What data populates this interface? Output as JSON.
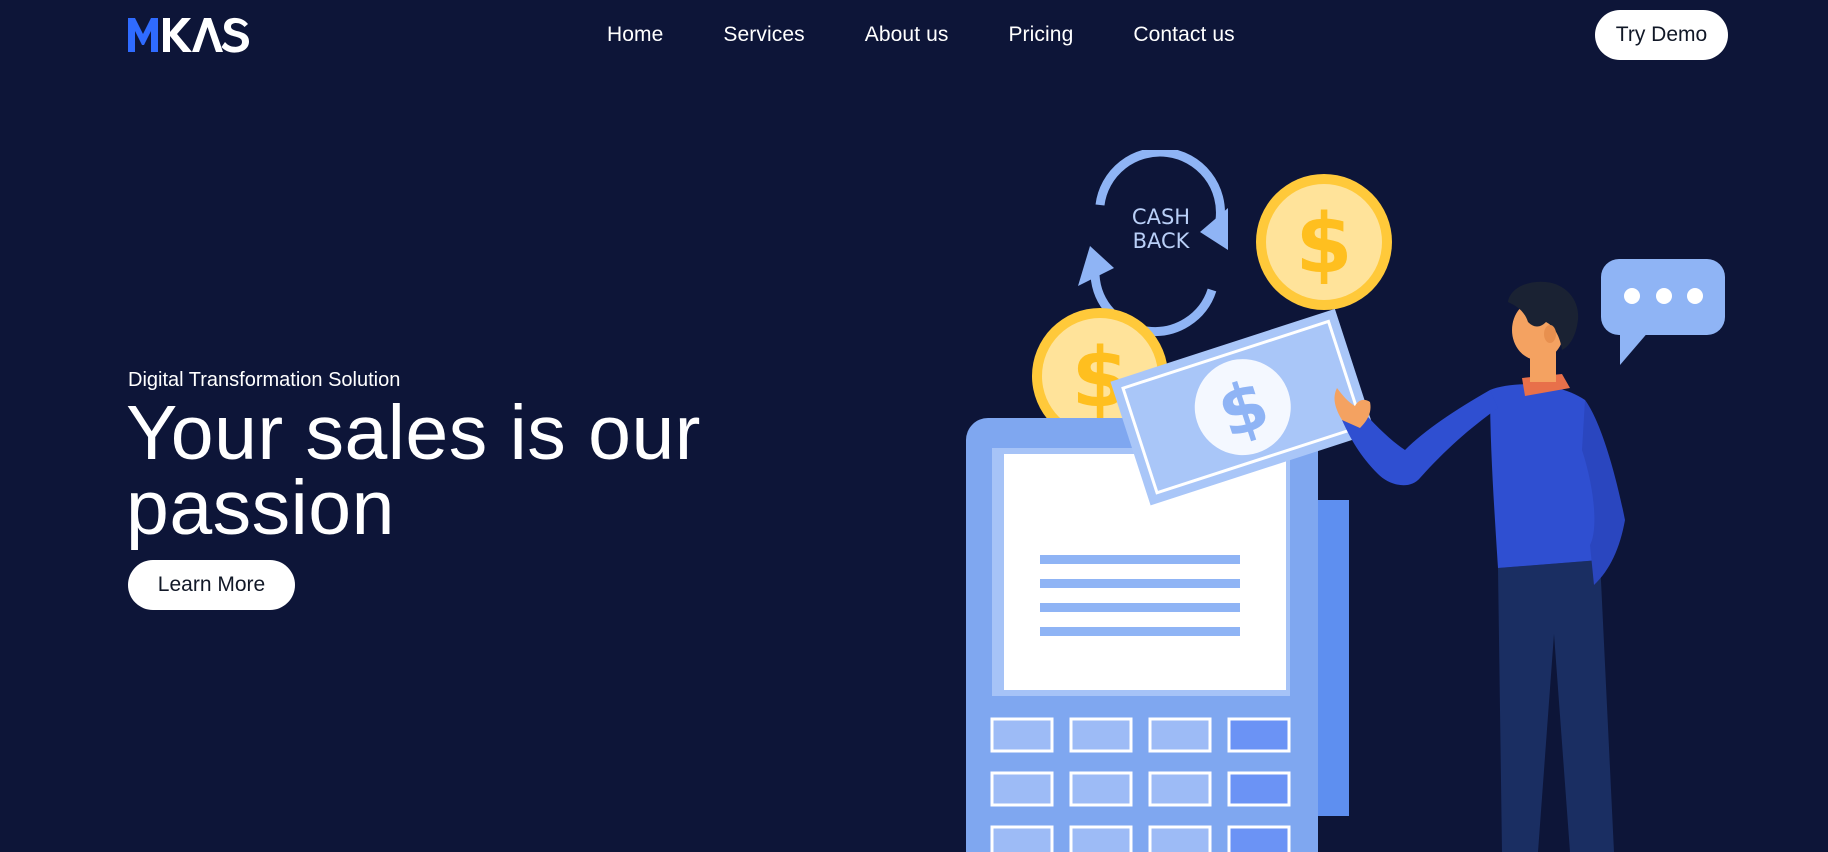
{
  "header": {
    "logo_text": "MKAS",
    "nav": [
      "Home",
      "Services",
      "About us",
      "Pricing",
      "Contact us"
    ],
    "cta_label": "Try Demo"
  },
  "hero": {
    "tagline": "Digital Transformation Solution",
    "headline": "Your sales is our passion",
    "button_label": "Learn More"
  },
  "illustration": {
    "cashback_line1": "CASH",
    "cashback_line2": "BACK",
    "coin_symbol": "$",
    "bill_symbol": "$"
  },
  "colors": {
    "background": "#0d1538",
    "logo_accent": "#2f6bff",
    "coin": "#ffc93a",
    "terminal": "#7fa7f0"
  }
}
